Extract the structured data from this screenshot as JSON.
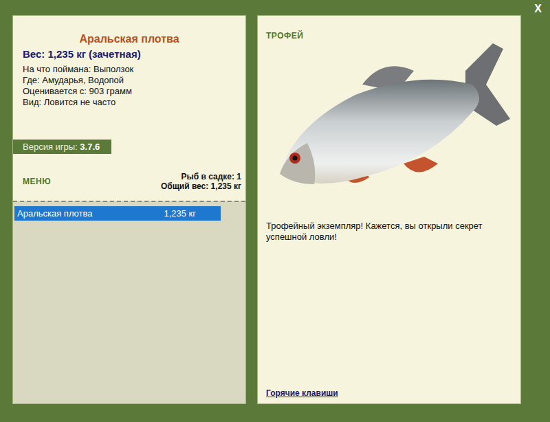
{
  "close": "X",
  "fish": {
    "name": "Аральская плотва",
    "weight": "Вес: 1,235 кг (зачетная)",
    "details": [
      "На что поймана: Выползок",
      "Где: Амударья, Водопой",
      "Оценивается с: 903 грамм",
      "Вид: Ловится не часто"
    ]
  },
  "version": {
    "label": "Версия игры:",
    "value": "3.7.6"
  },
  "menu": {
    "title": "МЕНЮ",
    "count": "Рыб в садке: 1",
    "total": "Общий вес: 1,235 кг"
  },
  "catch": [
    {
      "name": "Аральская плотва",
      "weight": "1,235 кг",
      "selected": true
    }
  ],
  "trophy": {
    "title": "ТРОФЕЙ",
    "message": "Трофейный экземпляр! Кажется, вы открыли секрет успешной ловли!",
    "hotkeys": "Горячие клавиши"
  }
}
